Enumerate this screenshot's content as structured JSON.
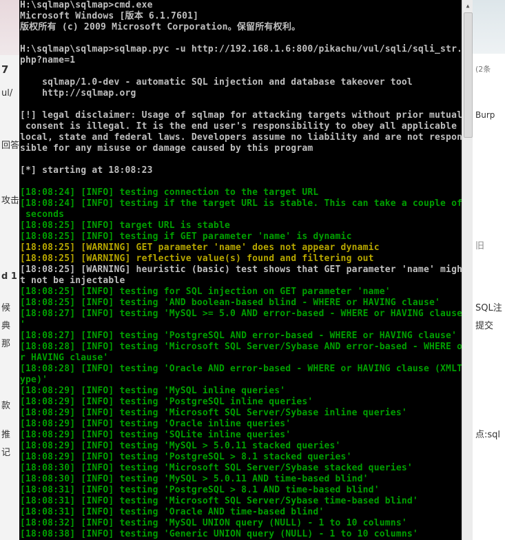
{
  "background_left": {
    "fragments": [
      "7",
      "ul/",
      "回答",
      "攻击",
      "d 1",
      "候",
      "典",
      "那",
      "款",
      "推",
      "记"
    ]
  },
  "background_right": {
    "fragments": [
      "(2条",
      "Burp",
      "旧",
      "SQL注",
      "提交",
      "点:sql"
    ]
  },
  "console": {
    "lines": [
      {
        "text": "H:\\sqlmap\\sqlmap>cmd.exe",
        "color": "white"
      },
      {
        "text": "Microsoft Windows [版本 6.1.7601]",
        "color": "white"
      },
      {
        "text": "版权所有 (c) 2009 Microsoft Corporation。保留所有权利。",
        "color": "white"
      },
      {
        "text": "",
        "color": "white"
      },
      {
        "text": "H:\\sqlmap\\sqlmap>sqlmap.pyc -u http://192.168.1.6:800/pikachu/vul/sqli/sqli_str.",
        "color": "white"
      },
      {
        "text": "php?name=1",
        "color": "white"
      },
      {
        "text": "",
        "color": "white"
      },
      {
        "text": "    sqlmap/1.0-dev - automatic SQL injection and database takeover tool",
        "color": "white"
      },
      {
        "text": "    http://sqlmap.org",
        "color": "white"
      },
      {
        "text": "",
        "color": "white"
      },
      {
        "text": "[!] legal disclaimer: Usage of sqlmap for attacking targets without prior mutual",
        "color": "white"
      },
      {
        "text": " consent is illegal. It is the end user's responsibility to obey all applicable",
        "color": "white"
      },
      {
        "text": "local, state and federal laws. Developers assume no liability and are not respon",
        "color": "white"
      },
      {
        "text": "sible for any misuse or damage caused by this program",
        "color": "white"
      },
      {
        "text": "",
        "color": "white"
      },
      {
        "text": "[*] starting at 18:08:23",
        "color": "white"
      },
      {
        "text": "",
        "color": "white"
      },
      {
        "text": "[18:08:24] [INFO] testing connection to the target URL",
        "color": "green"
      },
      {
        "text": "[18:08:24] [INFO] testing if the target URL is stable. This can take a couple of",
        "color": "green"
      },
      {
        "text": " seconds",
        "color": "green"
      },
      {
        "text": "[18:08:25] [INFO] target URL is stable",
        "color": "green"
      },
      {
        "text": "[18:08:25] [INFO] testing if GET parameter 'name' is dynamic",
        "color": "green"
      },
      {
        "text": "[18:08:25] [WARNING] GET parameter 'name' does not appear dynamic",
        "color": "yellow"
      },
      {
        "text": "[18:08:25] [WARNING] reflective value(s) found and filtering out",
        "color": "yellow"
      },
      {
        "text": "[18:08:25] [WARNING] heuristic (basic) test shows that GET parameter 'name' migh",
        "color": "white"
      },
      {
        "text": "t not be injectable",
        "color": "white"
      },
      {
        "text": "[18:08:25] [INFO] testing for SQL injection on GET parameter 'name'",
        "color": "green"
      },
      {
        "text": "[18:08:25] [INFO] testing 'AND boolean-based blind - WHERE or HAVING clause'",
        "color": "green"
      },
      {
        "text": "[18:08:27] [INFO] testing 'MySQL >= 5.0 AND error-based - WHERE or HAVING clause",
        "color": "green"
      },
      {
        "text": "'",
        "color": "green"
      },
      {
        "text": "[18:08:27] [INFO] testing 'PostgreSQL AND error-based - WHERE or HAVING clause'",
        "color": "green"
      },
      {
        "text": "[18:08:28] [INFO] testing 'Microsoft SQL Server/Sybase AND error-based - WHERE o",
        "color": "green"
      },
      {
        "text": "r HAVING clause'",
        "color": "green"
      },
      {
        "text": "[18:08:28] [INFO] testing 'Oracle AND error-based - WHERE or HAVING clause (XMLT",
        "color": "green"
      },
      {
        "text": "ype)'",
        "color": "green"
      },
      {
        "text": "[18:08:29] [INFO] testing 'MySQL inline queries'",
        "color": "green"
      },
      {
        "text": "[18:08:29] [INFO] testing 'PostgreSQL inline queries'",
        "color": "green"
      },
      {
        "text": "[18:08:29] [INFO] testing 'Microsoft SQL Server/Sybase inline queries'",
        "color": "green"
      },
      {
        "text": "[18:08:29] [INFO] testing 'Oracle inline queries'",
        "color": "green"
      },
      {
        "text": "[18:08:29] [INFO] testing 'SQLite inline queries'",
        "color": "green"
      },
      {
        "text": "[18:08:29] [INFO] testing 'MySQL > 5.0.11 stacked queries'",
        "color": "green"
      },
      {
        "text": "[18:08:29] [INFO] testing 'PostgreSQL > 8.1 stacked queries'",
        "color": "green"
      },
      {
        "text": "[18:08:30] [INFO] testing 'Microsoft SQL Server/Sybase stacked queries'",
        "color": "green"
      },
      {
        "text": "[18:08:30] [INFO] testing 'MySQL > 5.0.11 AND time-based blind'",
        "color": "green"
      },
      {
        "text": "[18:08:31] [INFO] testing 'PostgreSQL > 8.1 AND time-based blind'",
        "color": "green"
      },
      {
        "text": "[18:08:31] [INFO] testing 'Microsoft SQL Server/Sybase time-based blind'",
        "color": "green"
      },
      {
        "text": "[18:08:31] [INFO] testing 'Oracle AND time-based blind'",
        "color": "green"
      },
      {
        "text": "[18:08:32] [INFO] testing 'MySQL UNION query (NULL) - 1 to 10 columns'",
        "color": "green"
      },
      {
        "text": "[18:08:38] [INFO] testing 'Generic UNION query (NULL) - 1 to 10 columns'",
        "color": "green"
      }
    ]
  },
  "colors": {
    "console_bg": "#000000",
    "text_white": "#c0c0c0",
    "text_green": "#00a000",
    "text_yellow": "#b8a800"
  }
}
